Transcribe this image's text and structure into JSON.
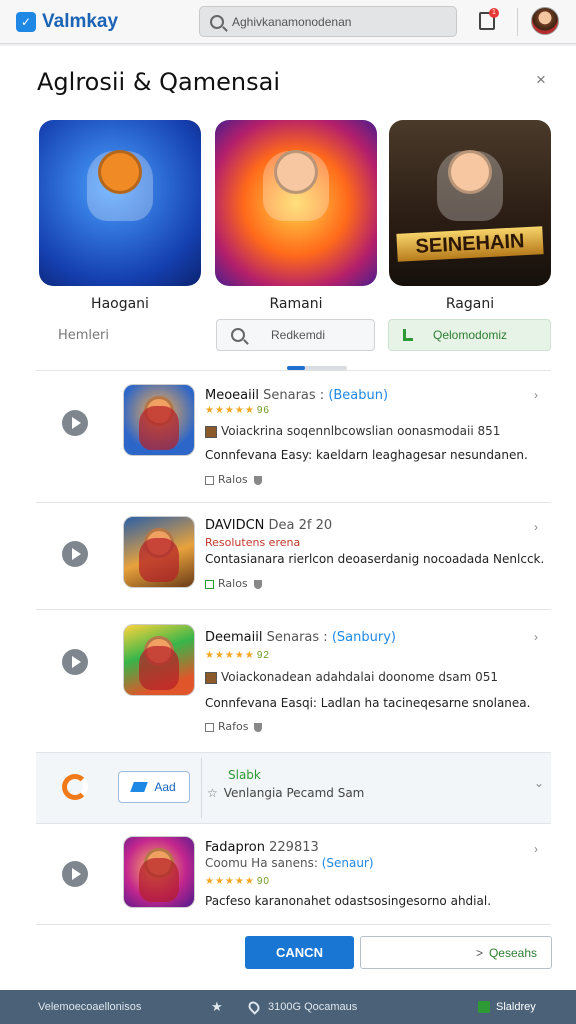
{
  "header": {
    "brand_name": "Valmkay",
    "search_value": "Aghivkanamonodenan",
    "notif_count": "1"
  },
  "panel": {
    "title": "Aglrosii & Qamensai",
    "close_glyph": "×"
  },
  "featured": [
    {
      "label": "Haogani",
      "sub": "Hemleri"
    },
    {
      "label": "Ramani",
      "button": "Redkemdi"
    },
    {
      "label": "Ragani",
      "banner": "SEINEHAIN",
      "button": "Qelomodomiz"
    }
  ],
  "rows": [
    {
      "title": "Meoeaiil",
      "meta": "Senaras :",
      "tag": "(Beabun)",
      "stars": "★★★★★",
      "rating": "96",
      "link": "Voiackrina soqennlbcowslian oonasmodaii 851",
      "desc": "Connfevana Easy: kaeldarn leaghagesar nesundanen.",
      "info": "Ralos"
    },
    {
      "title": "DAVIDCN",
      "meta": "Dea 2f 20",
      "stars": "",
      "rating": "",
      "link": "Resolutens erena",
      "desc": "Contasianara rierlcon deoaserdanig nocoadada Nenlcck.",
      "info": "Ralos"
    },
    {
      "title": "Deemaiil",
      "meta": "Senaras :",
      "tag": "(Sanbury)",
      "stars": "★★★★★",
      "rating": "92",
      "link": "Voiackonadean adahdalai doonome dsam 051",
      "desc": "Connfevana Easqi: Ladlan ha tacineqesarne snolanea.",
      "info": "Rafos"
    },
    {
      "title": "Fadapron",
      "meta": "229813",
      "sub": "Coomu Ha sanens:",
      "tag": "(Senaur)",
      "stars": "★★★★★",
      "rating": "90",
      "desc": "Pacfeso karanonahet odastsosingesorno ahdial."
    }
  ],
  "highlight": {
    "add_label": "Aad",
    "status": "Slabk",
    "sub": "Venlangia Pecamd Sam"
  },
  "buttons": {
    "cancel": "CANCN",
    "secondary_arrow": ">",
    "secondary": "Qeseahs"
  },
  "footer": {
    "left": "Velemoecoaellonisos",
    "mid": "3100G  Qocamaus",
    "right": "Slaldrey"
  }
}
